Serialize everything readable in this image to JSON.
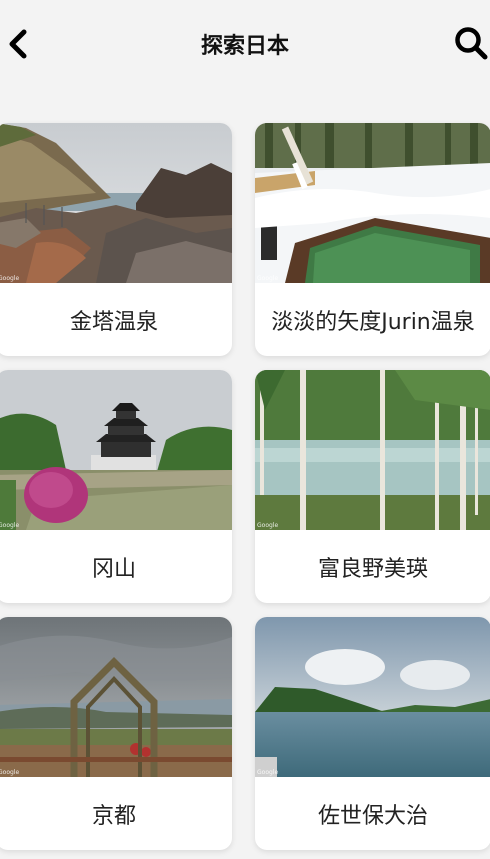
{
  "header": {
    "title": "探索日本",
    "back_icon": "chevron-left-icon",
    "search_icon": "search-icon"
  },
  "places": [
    {
      "label": "金塔温泉",
      "photo": "rocky-coast-hot-spring"
    },
    {
      "label": "淡淡的矢度Jurin温泉",
      "photo": "snowy-outdoor-bath"
    },
    {
      "label": "冈山",
      "photo": "okayama-castle"
    },
    {
      "label": "富良野美瑛",
      "photo": "blue-pond-birch-trees"
    },
    {
      "label": "京都",
      "photo": "amanohashidate-arch-view"
    },
    {
      "label": "佐世保大治",
      "photo": "lake-green-hills"
    }
  ],
  "attribution": "Google"
}
